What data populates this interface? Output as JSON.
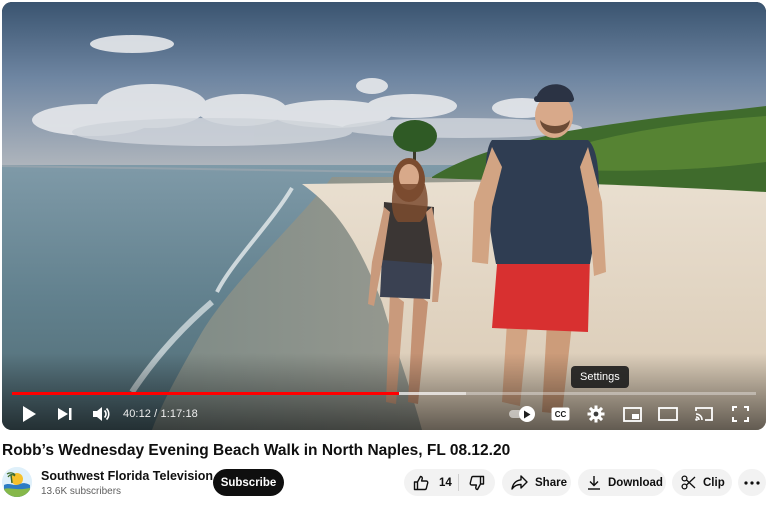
{
  "player": {
    "time_current": "40:12",
    "time_separator": " / ",
    "time_total": "1:17:18",
    "progress_fraction": 0.52,
    "buffered_fraction": 0.61,
    "tooltip": "Settings",
    "autoplay_on": true
  },
  "video": {
    "title": "Robb’s Wednesday Evening Beach Walk in North Naples, FL 08.12.20"
  },
  "channel": {
    "name": "Southwest Florida Television",
    "subscribers": "13.6K subscribers",
    "subscribe_label": "Subscribe"
  },
  "actions": {
    "like_count": "14",
    "share_label": "Share",
    "download_label": "Download",
    "clip_label": "Clip"
  },
  "colors": {
    "progress": "#ff0000",
    "subscribe_bg": "#0f0f0f",
    "pill_bg": "#f2f2f2"
  },
  "icons": [
    "play-icon",
    "next-icon",
    "volume-icon",
    "autoplay-toggle",
    "captions-icon",
    "settings-icon",
    "miniplayer-icon",
    "theater-icon",
    "cast-icon",
    "fullscreen-icon",
    "like-icon",
    "dislike-icon",
    "share-icon",
    "download-icon",
    "clip-icon",
    "more-icon"
  ]
}
